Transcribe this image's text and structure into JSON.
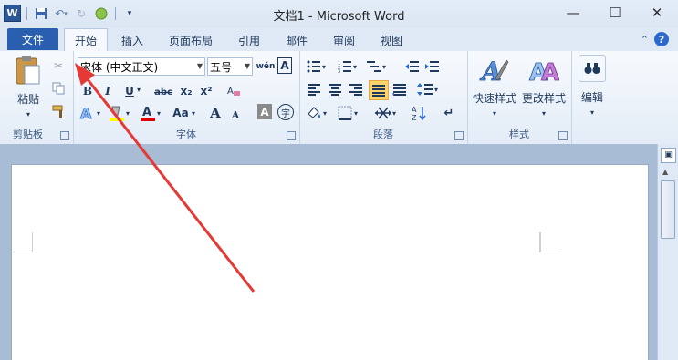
{
  "titlebar": {
    "title": "文档1 - Microsoft Word",
    "word_logo": "W",
    "minimize_glyph": "—",
    "maximize_glyph": "☐",
    "close_glyph": "✕"
  },
  "tabs": {
    "file": "文件",
    "home": "开始",
    "insert": "插入",
    "page_layout": "页面布局",
    "references": "引用",
    "mailings": "邮件",
    "review": "审阅",
    "view": "视图"
  },
  "clipboard": {
    "paste": "粘贴",
    "group_label": "剪贴板"
  },
  "font": {
    "font_name": "宋体 (中文正文)",
    "font_size": "五号",
    "bold": "B",
    "italic": "I",
    "underline": "U",
    "strikethrough": "abc",
    "subscript": "x₂",
    "superscript": "x²",
    "change_case": "Aa",
    "grow": "A",
    "shrink": "A",
    "phonetic": "wén",
    "border_char": "A",
    "shade_char": "A",
    "enclose_char": "字",
    "group_label": "字体"
  },
  "paragraph": {
    "group_label": "段落"
  },
  "styles": {
    "quick_styles": "快速样式",
    "change_styles": "更改样式",
    "group_label": "样式"
  },
  "editing": {
    "label": "编辑"
  },
  "colors": {
    "file_tab": "#2a5fb0",
    "accent_arrow": "#e53935",
    "highlight_yellow": "#ffff00",
    "font_color_red": "#e00000"
  }
}
